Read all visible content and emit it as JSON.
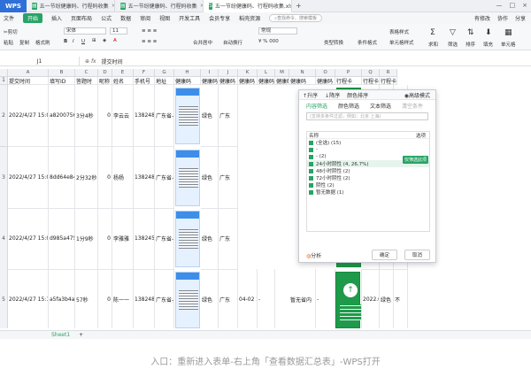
{
  "tabs": [
    {
      "label": "WPS"
    },
    {
      "label": "五一节纷健康码、行程码收集"
    },
    {
      "label": "五一节纷健康码、行程码收集"
    },
    {
      "label": "五一节纷健康码、行程码收集.xlsx"
    }
  ],
  "menu": {
    "items": [
      "文件",
      "开始",
      "插入",
      "页面布局",
      "公式",
      "数据",
      "审阅",
      "视图",
      "开发工具",
      "会员专享",
      "稻壳资源"
    ],
    "search": "查找命令、搜索模板",
    "right": [
      "有修改",
      "协作",
      "分享"
    ]
  },
  "toolbar": {
    "cut": "剪切",
    "copy": "复制",
    "paste": "粘贴",
    "format_painter": "格式刷",
    "font": "宋体",
    "size": "11",
    "merge": "合并居中",
    "wrap": "自动换行",
    "number_format": "常规",
    "convert": "类型转换",
    "cond_format": "条件格式",
    "table_style": "表格样式",
    "cell_style": "单元格样式",
    "sum": "求和",
    "filter": "筛选",
    "sort": "排序",
    "fill": "填充",
    "cell": "单元格"
  },
  "formula": {
    "namebox": "J1",
    "content": "提交时间"
  },
  "columns": [
    "A",
    "B",
    "C",
    "D",
    "E",
    "F",
    "G",
    "H",
    "I",
    "J",
    "K",
    "L",
    "M",
    "N",
    "O",
    "P",
    "Q",
    "R"
  ],
  "header_row": [
    "提交时间",
    "填写ID",
    "答题时",
    "昵称",
    "姓名",
    "手机号",
    "地址",
    "健康码",
    "健康码",
    "健康码",
    "健康码",
    "健康码",
    "健康码",
    "健康码",
    "健康码",
    "行程卡",
    "行程卡",
    "行程卡"
  ],
  "rows": [
    {
      "num": "2",
      "time": "2022/4/27 15:00",
      "id": "a8200756",
      "dur": "3分4秒",
      "nick": "0",
      "name": "李云云",
      "phone": "13824881",
      "addr": "广东省-广",
      "color": "绿色",
      "region": "广东",
      "trip_date": "2022.04.",
      "trip_color": "绿色",
      "extra": "不"
    },
    {
      "num": "3",
      "time": "2022/4/27 15:03",
      "id": "8dd64e84",
      "dur": "2分32秒",
      "nick": "0",
      "name": "杨杨",
      "phone": "13824882",
      "addr": "广东省-广",
      "color": "绿色",
      "region": "广东",
      "trip_date": "2022.04.",
      "trip_color": "绿色",
      "extra": "不"
    },
    {
      "num": "4",
      "time": "2022/4/27 15:04",
      "id": "d985a475",
      "dur": "1分9秒",
      "nick": "0",
      "name": "李雅雅",
      "phone": "13824551",
      "addr": "广东省-广",
      "color": "绿色",
      "region": "广东",
      "trip_date": "2022.04.",
      "trip_color": "绿色",
      "extra": "不"
    },
    {
      "num": "5",
      "time": "2022/4/27 15:14",
      "id": "a5fa3b4a",
      "dur": "57秒",
      "nick": "0",
      "name": "陈一一",
      "phone": "13824883",
      "addr": "广东省-广",
      "color": "绿色",
      "region": "广东",
      "mdate": "04-02 20",
      "dash": "-",
      "shown": "暂无省内",
      "dash2": "-",
      "noinfo": "暂无数据",
      "trip_date": "2022.04.",
      "trip_color": "绿色",
      "extra": "不"
    }
  ],
  "panel": {
    "sort_asc": "升序",
    "sort_desc": "降序",
    "color_sort": "颜色排序",
    "advanced": "高级模式",
    "tab_content": "内容筛选",
    "tab_color": "颜色筛选",
    "tab_text": "文本筛选",
    "clear": "清空条件",
    "search_placeholder": "(支持多条件过滤，例如：北京 上海)",
    "list_header": "名称",
    "options": "选项",
    "items": [
      "(全选) (15)",
      "-",
      "- (2)",
      "24小时阴性 (4, 26.7%)",
      "48小时阴性 (2)",
      "72小时阴性 (2)",
      "阴性 (2)",
      "暂无数据 (1)"
    ],
    "tooltip": "仅筛选此项",
    "analysis": "分析",
    "ok": "确定",
    "cancel": "取消"
  },
  "sheet": {
    "name": "Sheet1",
    "add": "+"
  },
  "caption": "入口：重新进入表单-右上角「查看数据汇总表」-WPS打开"
}
